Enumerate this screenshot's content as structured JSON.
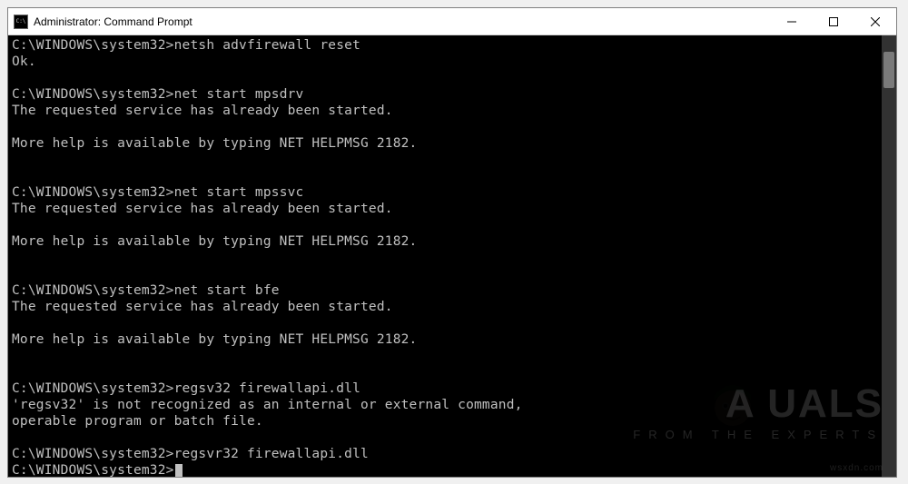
{
  "window": {
    "title": "Administrator: Command Prompt"
  },
  "terminal": {
    "prompt": "C:\\WINDOWS\\system32>",
    "entries": [
      {
        "cmd": "netsh advfirewall reset",
        "out": "Ok."
      },
      {
        "spacer": true
      },
      {
        "cmd": "net start mpsdrv",
        "out": "The requested service has already been started."
      },
      {
        "spacer": true
      },
      {
        "out": "More help is available by typing NET HELPMSG 2182."
      },
      {
        "spacer2": true
      },
      {
        "cmd": "net start mpssvc",
        "out": "The requested service has already been started."
      },
      {
        "spacer": true
      },
      {
        "out": "More help is available by typing NET HELPMSG 2182."
      },
      {
        "spacer2": true
      },
      {
        "cmd": "net start bfe",
        "out": "The requested service has already been started."
      },
      {
        "spacer": true
      },
      {
        "out": "More help is available by typing NET HELPMSG 2182."
      },
      {
        "spacer2": true
      },
      {
        "cmd": "regsv32 firewallapi.dll",
        "out": "'regsv32' is not recognized as an internal or external command,\noperable program or batch file."
      },
      {
        "spacer": true
      },
      {
        "cmd": "regsvr32 firewallapi.dll",
        "out": ""
      },
      {
        "cmd": "",
        "cursor": true
      }
    ]
  },
  "watermark": {
    "brand": "A   UALS",
    "tag": "FROM THE EXPERTS",
    "source": "wsxdn.com"
  }
}
